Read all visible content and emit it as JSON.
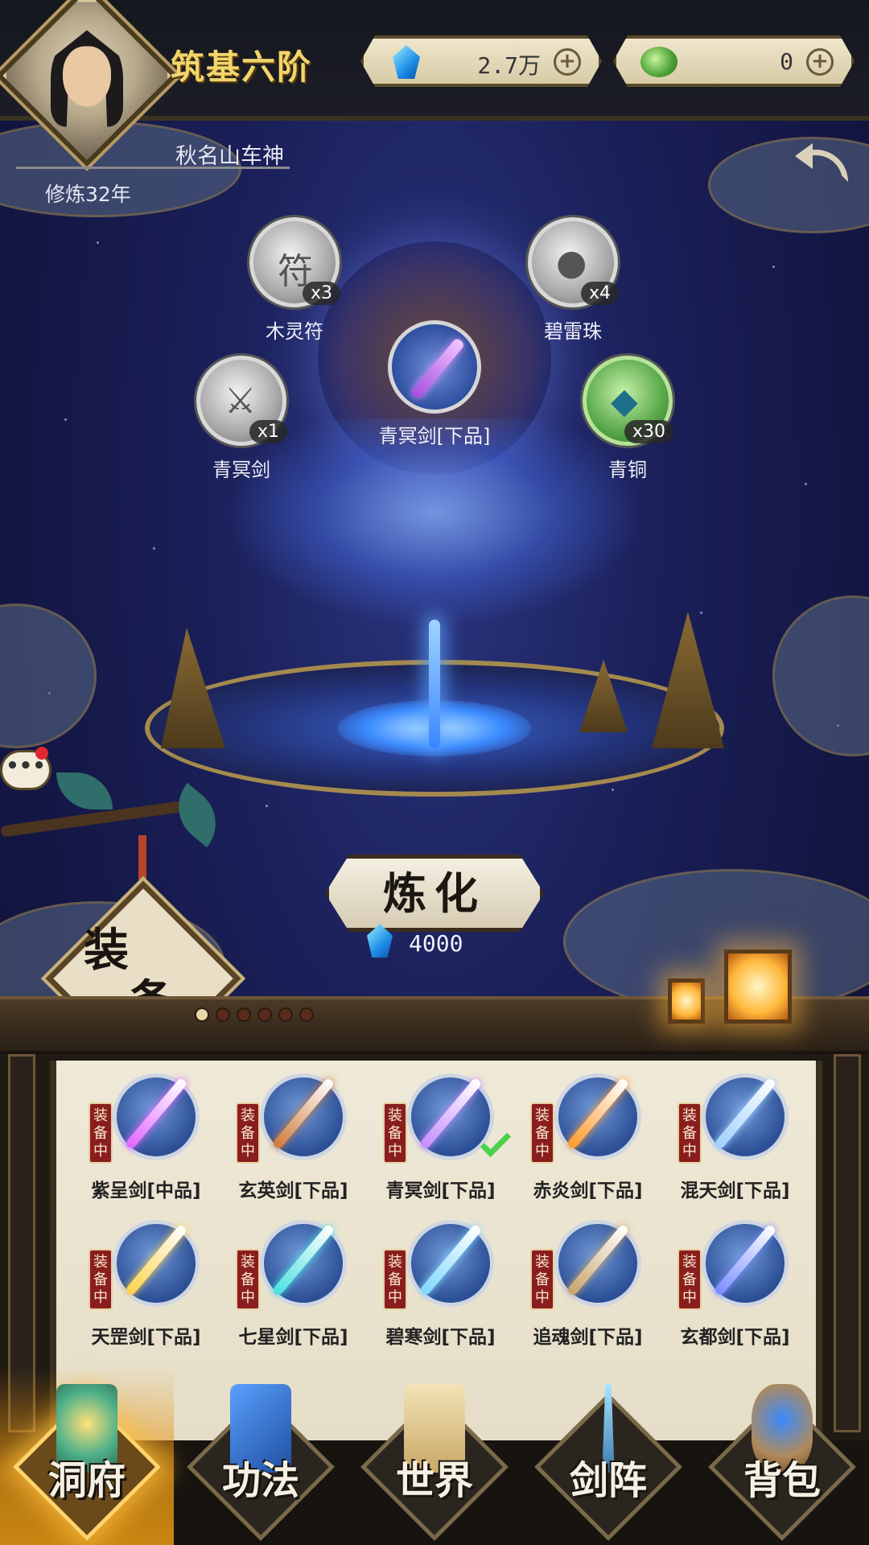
{
  "header": {
    "realm": "筑基六阶",
    "resources": [
      {
        "icon": "blue-gem-icon",
        "value": "2.7万"
      },
      {
        "icon": "jade-coin-icon",
        "value": "0"
      }
    ]
  },
  "player": {
    "name": "秋名山车神",
    "cultivation": "修炼32年"
  },
  "ingredients": [
    {
      "name": "木灵符",
      "count": "x3",
      "icon": "talisman-icon"
    },
    {
      "name": "碧雷珠",
      "count": "x4",
      "icon": "thunder-pearl-icon"
    },
    {
      "name": "青冥剑",
      "count": "x1",
      "icon": "sword-icon"
    },
    {
      "name": "青铜",
      "count": "x30",
      "icon": "bronze-ore-icon"
    }
  ],
  "target": {
    "name": "青冥剑[下品]"
  },
  "refine": {
    "label": "炼化",
    "cost": "4000"
  },
  "equip_tag": {
    "char1": "装",
    "char2": "备"
  },
  "colors": {
    "accent_gold": "#f2d56b",
    "equipped_badge": "#8a1e1e",
    "check": "#4bd04b"
  },
  "equipment": {
    "badge": "装备中",
    "items": [
      {
        "name": "紫呈剑[中品]",
        "blade": "#e066ff",
        "equipped": true
      },
      {
        "name": "玄英剑[下品]",
        "blade": "#d07a3a",
        "equipped": true
      },
      {
        "name": "青冥剑[下品]",
        "blade": "#c58cff",
        "equipped": true,
        "selected": true
      },
      {
        "name": "赤炎剑[下品]",
        "blade": "#ff9a2a",
        "equipped": true
      },
      {
        "name": "混天剑[下品]",
        "blade": "#9fd0ff",
        "equipped": true
      },
      {
        "name": "天罡剑[下品]",
        "blade": "#ffd24a",
        "equipped": true
      },
      {
        "name": "七星剑[下品]",
        "blade": "#4ae0e0",
        "equipped": true
      },
      {
        "name": "碧寒剑[下品]",
        "blade": "#7fd8ff",
        "equipped": true
      },
      {
        "name": "追魂剑[下品]",
        "blade": "#c9a46a",
        "equipped": true
      },
      {
        "name": "玄都剑[下品]",
        "blade": "#7a8cff",
        "equipped": true
      }
    ]
  },
  "nav": [
    {
      "label": "洞府",
      "icon": "cave-abode-icon",
      "active": true
    },
    {
      "label": "功法",
      "icon": "scripture-book-icon",
      "active": false
    },
    {
      "label": "世界",
      "icon": "world-scroll-icon",
      "active": false
    },
    {
      "label": "剑阵",
      "icon": "sword-array-icon",
      "active": false
    },
    {
      "label": "背包",
      "icon": "bag-icon",
      "active": false
    }
  ]
}
